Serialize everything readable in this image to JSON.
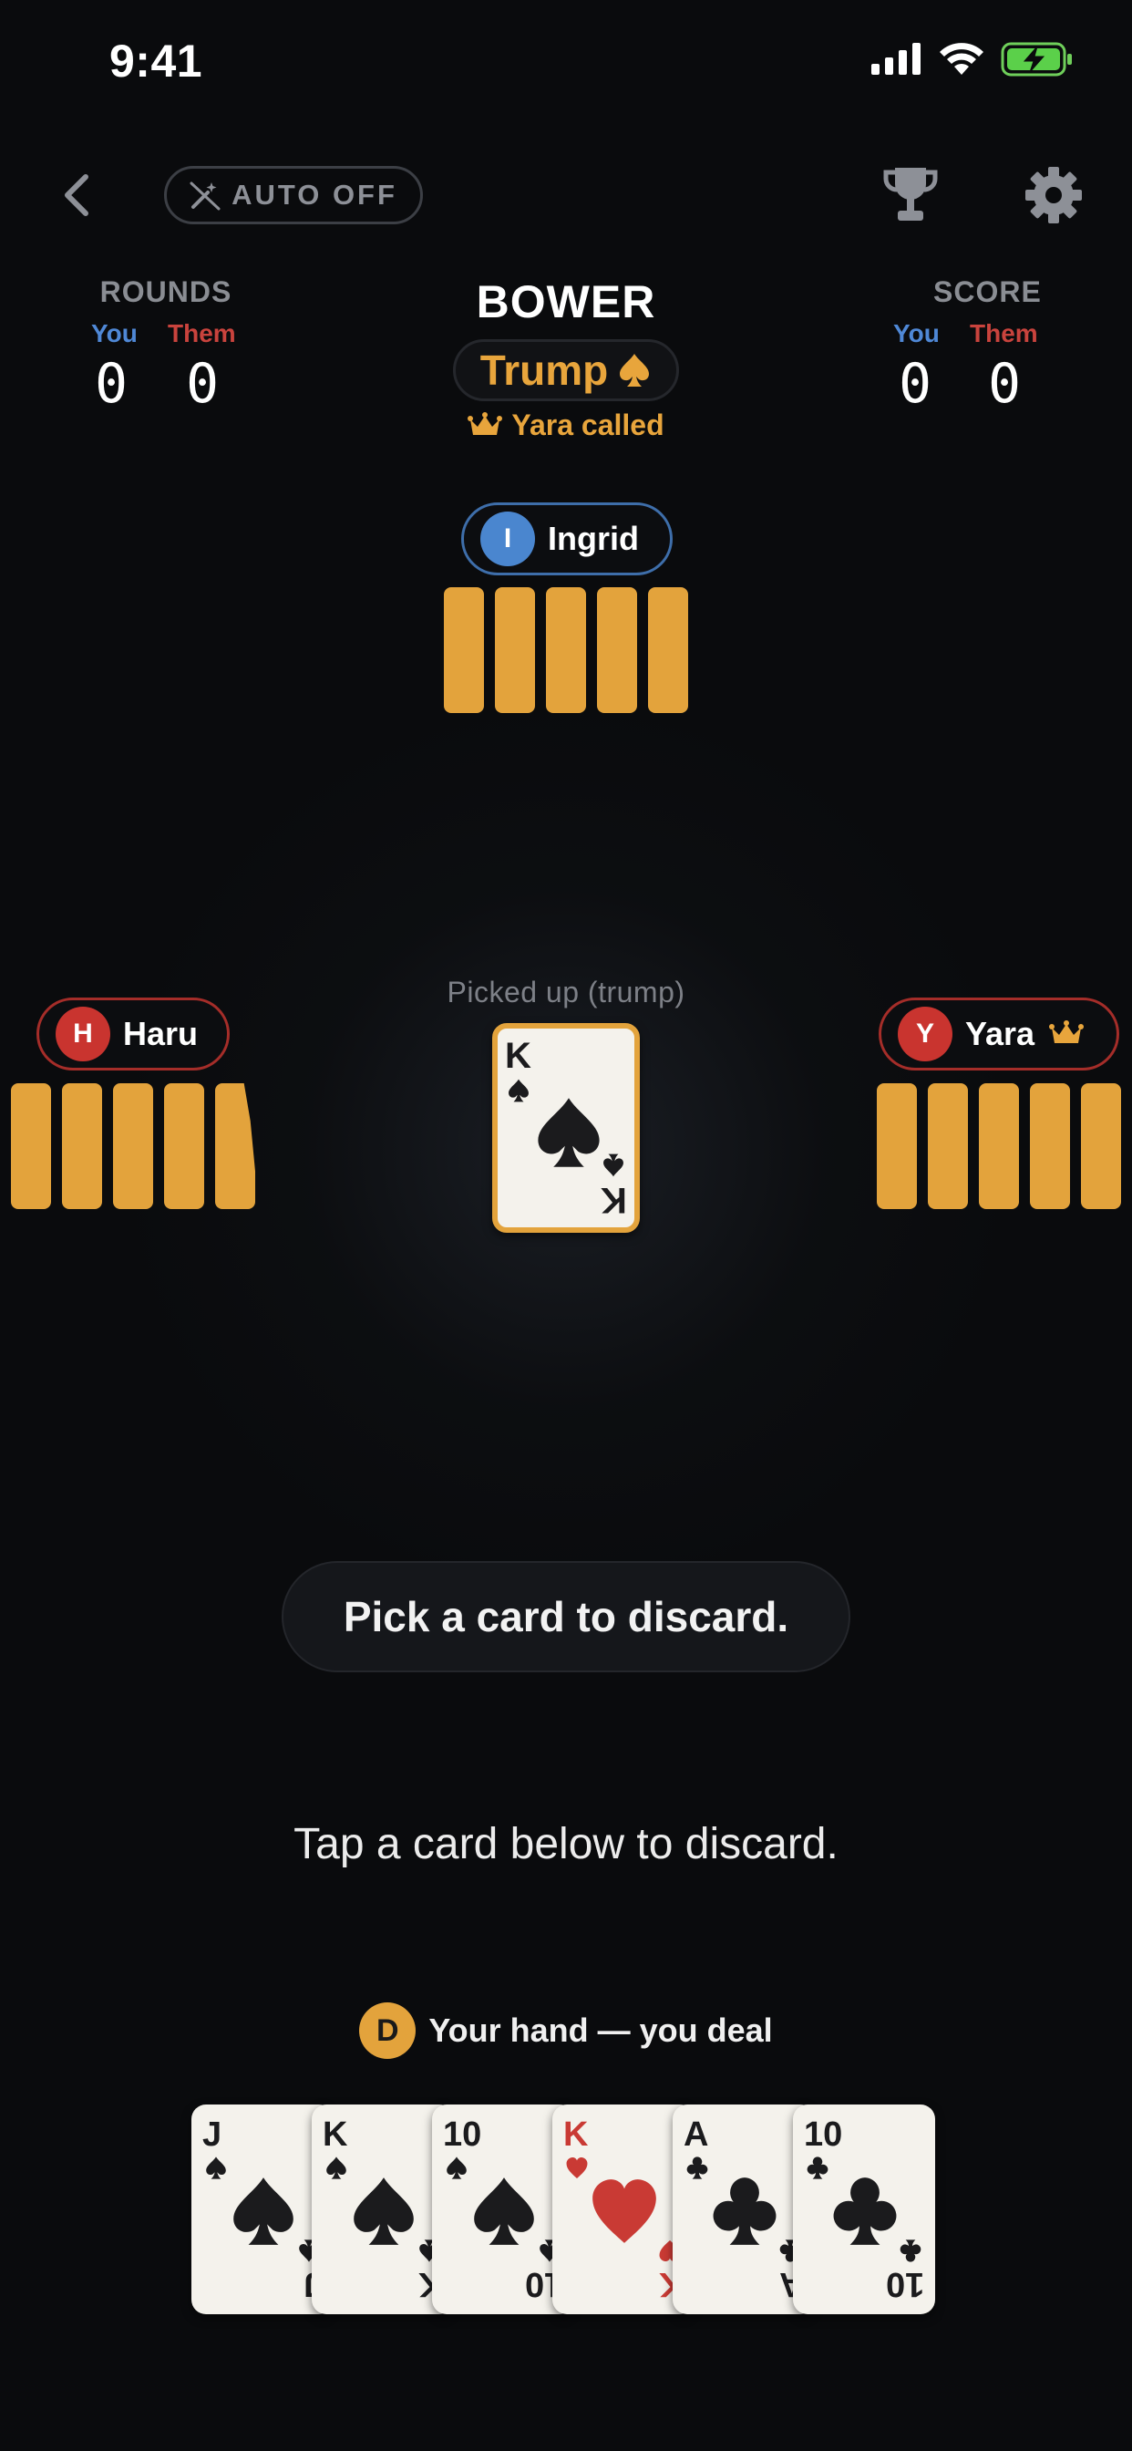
{
  "status_bar": {
    "time": "9:41"
  },
  "header": {
    "auto_label": "AUTO OFF",
    "game_title": "BOWER",
    "trump_label": "Trump",
    "trump_suit_icon": "spade-icon",
    "caller_text": "Yara called"
  },
  "rounds": {
    "label": "ROUNDS",
    "you_label": "You",
    "them_label": "Them",
    "you": "0",
    "them": "0"
  },
  "score": {
    "label": "SCORE",
    "you_label": "You",
    "them_label": "Them",
    "you": "0",
    "them": "0"
  },
  "players": {
    "top": {
      "initial": "I",
      "name": "Ingrid",
      "cards": 5,
      "color": "#4a86cf"
    },
    "left": {
      "initial": "H",
      "name": "Haru",
      "cards": 5,
      "color": "#c9342f"
    },
    "right": {
      "initial": "Y",
      "name": "Yara",
      "cards": 5,
      "color": "#c9342f",
      "is_caller": true
    }
  },
  "center": {
    "picked_label": "Picked up (trump)",
    "picked_card": {
      "rank": "K",
      "suit": "spades"
    }
  },
  "prompt": {
    "message": "Pick a card to discard.",
    "instruction": "Tap a card below to discard."
  },
  "hand": {
    "dealer_badge": "D",
    "label": "Your hand — you deal",
    "cards": [
      {
        "rank": "J",
        "suit": "spades"
      },
      {
        "rank": "K",
        "suit": "spades"
      },
      {
        "rank": "10",
        "suit": "spades"
      },
      {
        "rank": "K",
        "suit": "hearts"
      },
      {
        "rank": "A",
        "suit": "clubs"
      },
      {
        "rank": "10",
        "suit": "clubs"
      }
    ]
  },
  "colors": {
    "accent": "#e3a33c",
    "you": "#4f88d6",
    "them": "#c9433d",
    "background": "#0a0b0d"
  }
}
